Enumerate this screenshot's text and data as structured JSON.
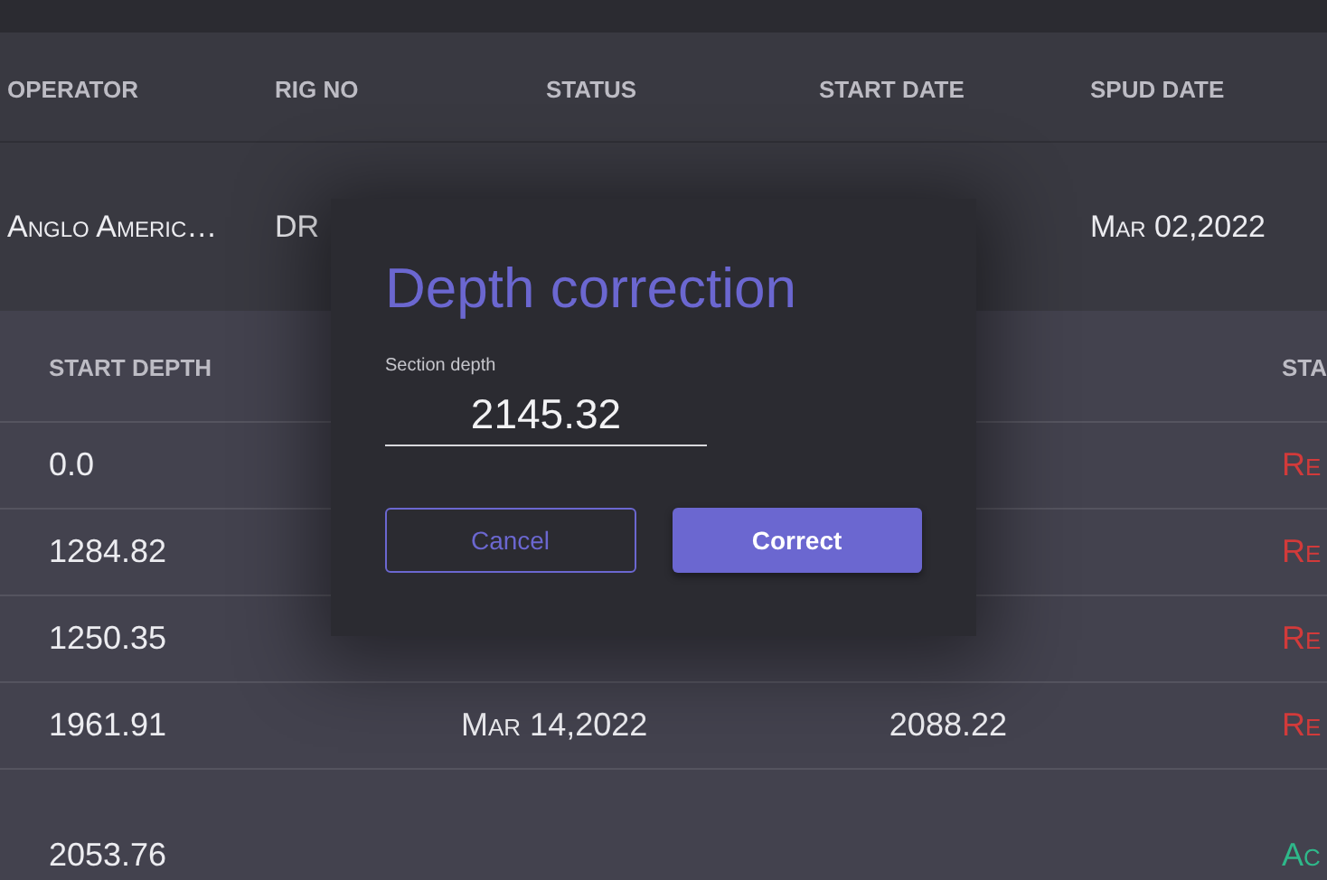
{
  "well_table": {
    "columns": [
      "OPERATOR",
      "RIG NO",
      "STATUS",
      "START DATE",
      "SPUD DATE"
    ],
    "rows": [
      {
        "cells": [
          "Anglo Americ…",
          "DR",
          "",
          "",
          "Mar 02,2022"
        ]
      }
    ]
  },
  "section_table": {
    "columns": [
      "START DEPTH",
      "",
      "",
      "STA"
    ],
    "rows": [
      {
        "cells": [
          "0.0",
          "",
          "",
          ""
        ],
        "status": "Re",
        "color": "#d23a3a"
      },
      {
        "cells": [
          "1284.82",
          "",
          "",
          ""
        ],
        "status": "Re",
        "color": "#d23a3a"
      },
      {
        "cells": [
          "1250.35",
          "",
          "",
          ""
        ],
        "status": "Re",
        "color": "#d23a3a"
      },
      {
        "cells": [
          "1961.91",
          "Mar 14,2022",
          "2088.22",
          ""
        ],
        "status": "Re",
        "color": "#d23a3a"
      },
      {
        "cells": [
          "2053.76",
          "",
          "",
          ""
        ],
        "status": "Ac",
        "color": "#2fb88a"
      }
    ]
  },
  "dialog": {
    "title": "Depth correction",
    "field": {
      "label": "Section depth",
      "value": "2145.32"
    },
    "buttons": [
      {
        "label": "Cancel",
        "kind": "outline"
      },
      {
        "label": "Correct",
        "kind": "filled"
      }
    ]
  }
}
